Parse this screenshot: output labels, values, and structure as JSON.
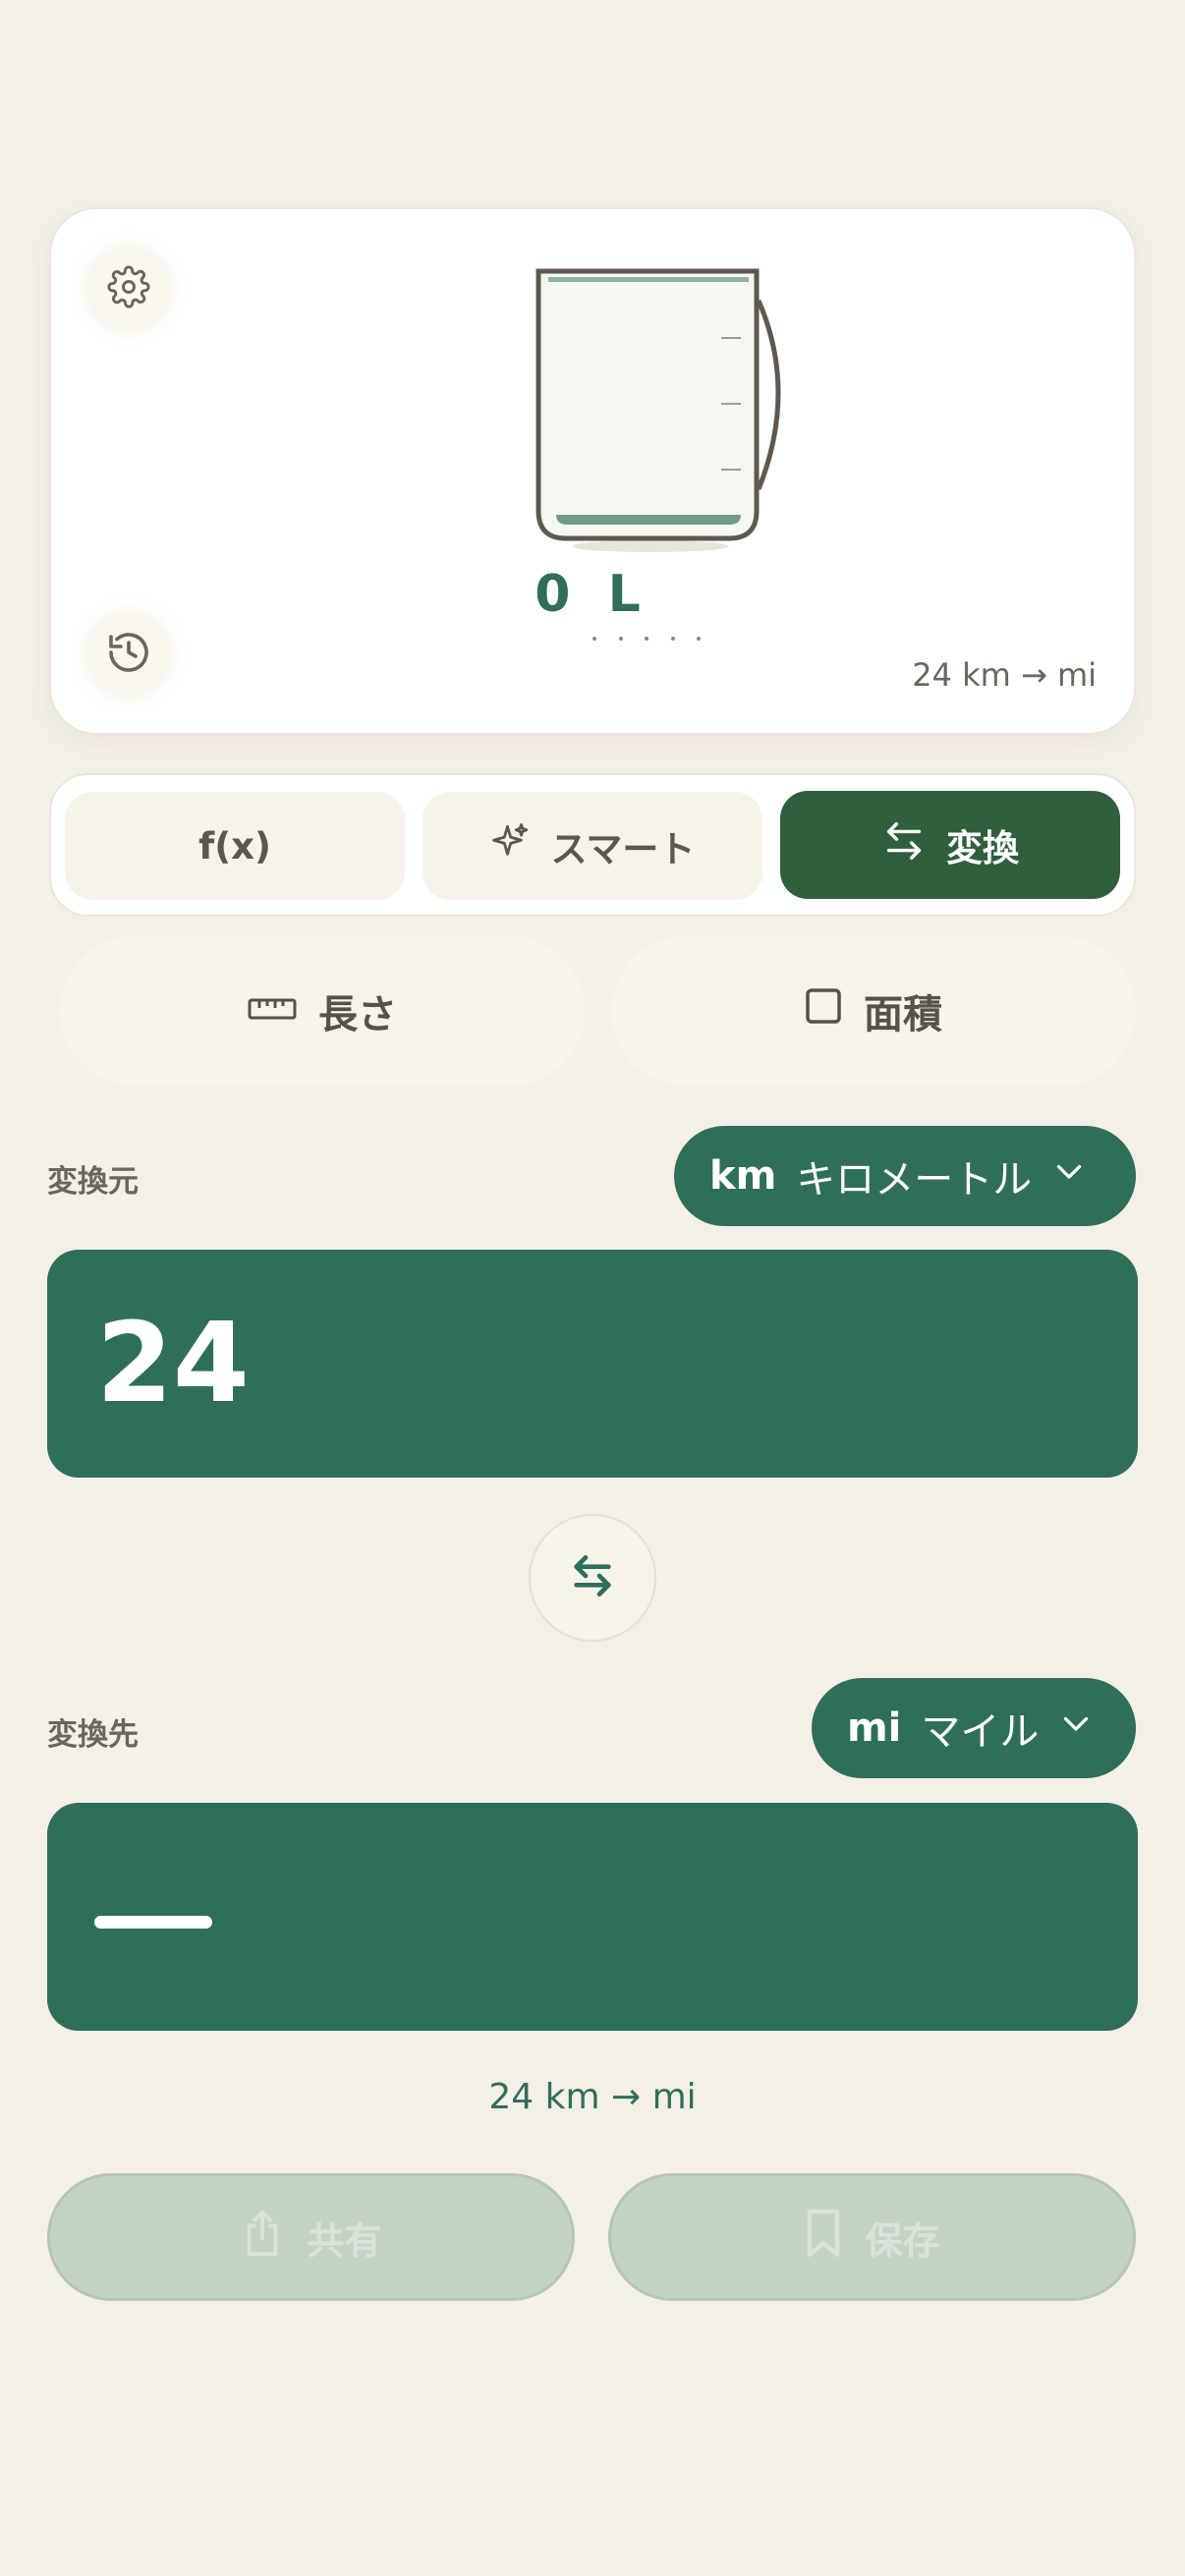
{
  "display": {
    "value": "0 L",
    "expression": "24 km → mi"
  },
  "modes": {
    "fx_label": "f(x)",
    "smart_label": "スマート",
    "convert_label": "変換"
  },
  "categories": {
    "length_label": "長さ",
    "area_label": "面積"
  },
  "from": {
    "label": "変換元",
    "unit_code": "km",
    "unit_name": "キロメートル",
    "value": "24"
  },
  "to": {
    "label": "変換先",
    "unit_code": "mi",
    "unit_name": "マイル",
    "value": "—"
  },
  "result_expression": "24 km → mi",
  "actions": {
    "share_label": "共有",
    "save_label": "保存"
  },
  "colors": {
    "background": "#f4efe7",
    "accent_green": "#2f6e5b",
    "active_mode": "#2f5f3c",
    "disabled_action": "#c4d3c5"
  }
}
